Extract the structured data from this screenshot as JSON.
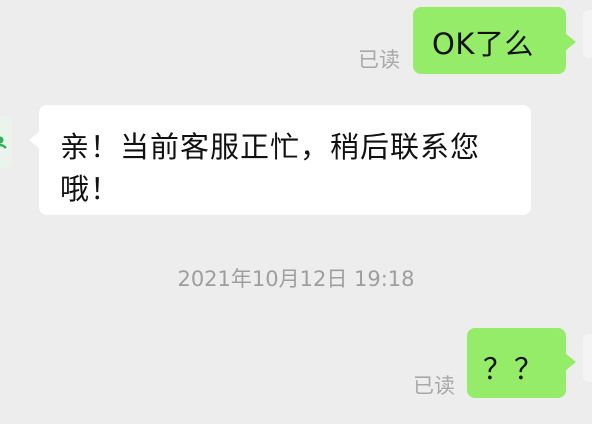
{
  "messages": [
    {
      "side": "sent",
      "text": "OK了么",
      "status": "已读"
    },
    {
      "side": "recv",
      "line1": "亲！当前客服正忙，稍后联系您",
      "line2": "哦！"
    },
    {
      "side": "sent",
      "text": "？？",
      "status": "已读"
    }
  ],
  "timestamp": "2021年10月12日 19:18",
  "colors": {
    "background": "#ededed",
    "sent_bubble": "#95ec69",
    "received_bubble": "#ffffff",
    "read_status": "#a8a8a8",
    "timestamp": "#9e9e9e"
  }
}
